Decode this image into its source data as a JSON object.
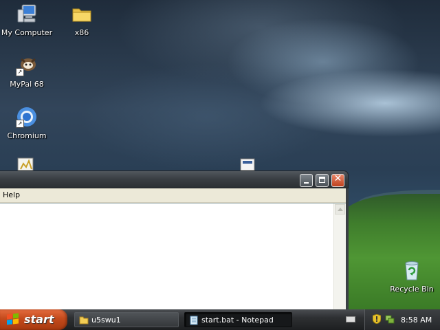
{
  "desktop": {
    "icons": [
      {
        "label": "My Computer",
        "icon": "computer-icon"
      },
      {
        "label": "x86",
        "icon": "folder-icon"
      },
      {
        "label": "MyPal 68",
        "icon": "mypal-browser-icon"
      },
      {
        "label": "Chromium",
        "icon": "chromium-icon"
      },
      {
        "label": "Recycle Bin",
        "icon": "recycle-bin-icon"
      }
    ]
  },
  "notepad": {
    "menu": {
      "help": "Help"
    },
    "content": ""
  },
  "taskbar": {
    "start_label": "start",
    "tasks": [
      {
        "label": "u5swu1",
        "icon": "folder-icon"
      },
      {
        "label": "start.bat - Notepad",
        "icon": "notepad-icon"
      }
    ],
    "clock": "8:58 AM"
  },
  "colors": {
    "start_button": "#c34a1c",
    "taskbar": "#2e3033",
    "titlebar": "#3a3f44",
    "close_button": "#c0411e"
  }
}
